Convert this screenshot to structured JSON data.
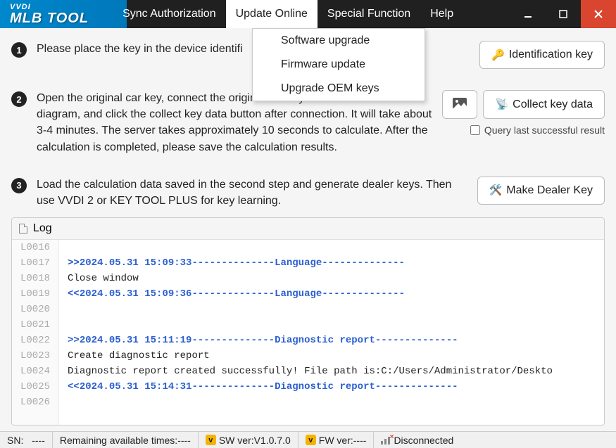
{
  "app": {
    "logo_small": "VVDI",
    "logo_big": "MLB TOOL"
  },
  "menu": {
    "sync": "Sync Authorization",
    "update": "Update Online",
    "special": "Special Function",
    "help": "Help"
  },
  "dropdown": {
    "software_upgrade": "Software upgrade",
    "firmware_update": "Firmware update",
    "upgrade_oem": "Upgrade OEM keys"
  },
  "steps": {
    "s1": {
      "num": "1",
      "text": "Please place the key in the device identifi",
      "button": "Identification key"
    },
    "s2": {
      "num": "2",
      "text": "Open the original car key, connect the original car key PCB as shown in the diagram, and click the collect key data button after connection. It will take about 3-4 minutes. The server takes approximately 10 seconds to calculate. After the calculation is completed, please save the calculation results.",
      "button": "Collect key data",
      "checkbox": "Query last successful result"
    },
    "s3": {
      "num": "3",
      "text": "Load the calculation data saved in the second step and generate dealer keys. Then use VVDI 2 or KEY TOOL PLUS for key learning.",
      "button": "Make Dealer Key"
    }
  },
  "log": {
    "title": "Log",
    "gutter": [
      "L0016",
      "L0017",
      "L0018",
      "L0019",
      "L0020",
      "L0021",
      "L0022",
      "L0023",
      "L0024",
      "L0025",
      "L0026"
    ],
    "lines": [
      {
        "cls": "log-normal",
        "text": ""
      },
      {
        "cls": "log-blue",
        "text": ">>2024.05.31 15:09:33--------------Language--------------"
      },
      {
        "cls": "log-normal",
        "text": "Close window"
      },
      {
        "cls": "log-blue",
        "text": "<<2024.05.31 15:09:36--------------Language--------------"
      },
      {
        "cls": "log-normal",
        "text": ""
      },
      {
        "cls": "log-normal",
        "text": ""
      },
      {
        "cls": "log-blue",
        "text": ">>2024.05.31 15:11:19--------------Diagnostic report--------------"
      },
      {
        "cls": "log-normal",
        "text": "Create diagnostic report"
      },
      {
        "cls": "log-normal",
        "text": "Diagnostic report created successfully! File path is:C:/Users/Administrator/Deskto"
      },
      {
        "cls": "log-blue",
        "text": "<<2024.05.31 15:14:31--------------Diagnostic report--------------"
      },
      {
        "cls": "log-normal",
        "text": ""
      }
    ]
  },
  "status": {
    "sn_label": "SN:",
    "sn_value": "----",
    "remaining": "Remaining available times:----",
    "sw": "SW ver:V1.0.7.0",
    "fw": "FW ver:----",
    "conn": "Disconnected"
  }
}
